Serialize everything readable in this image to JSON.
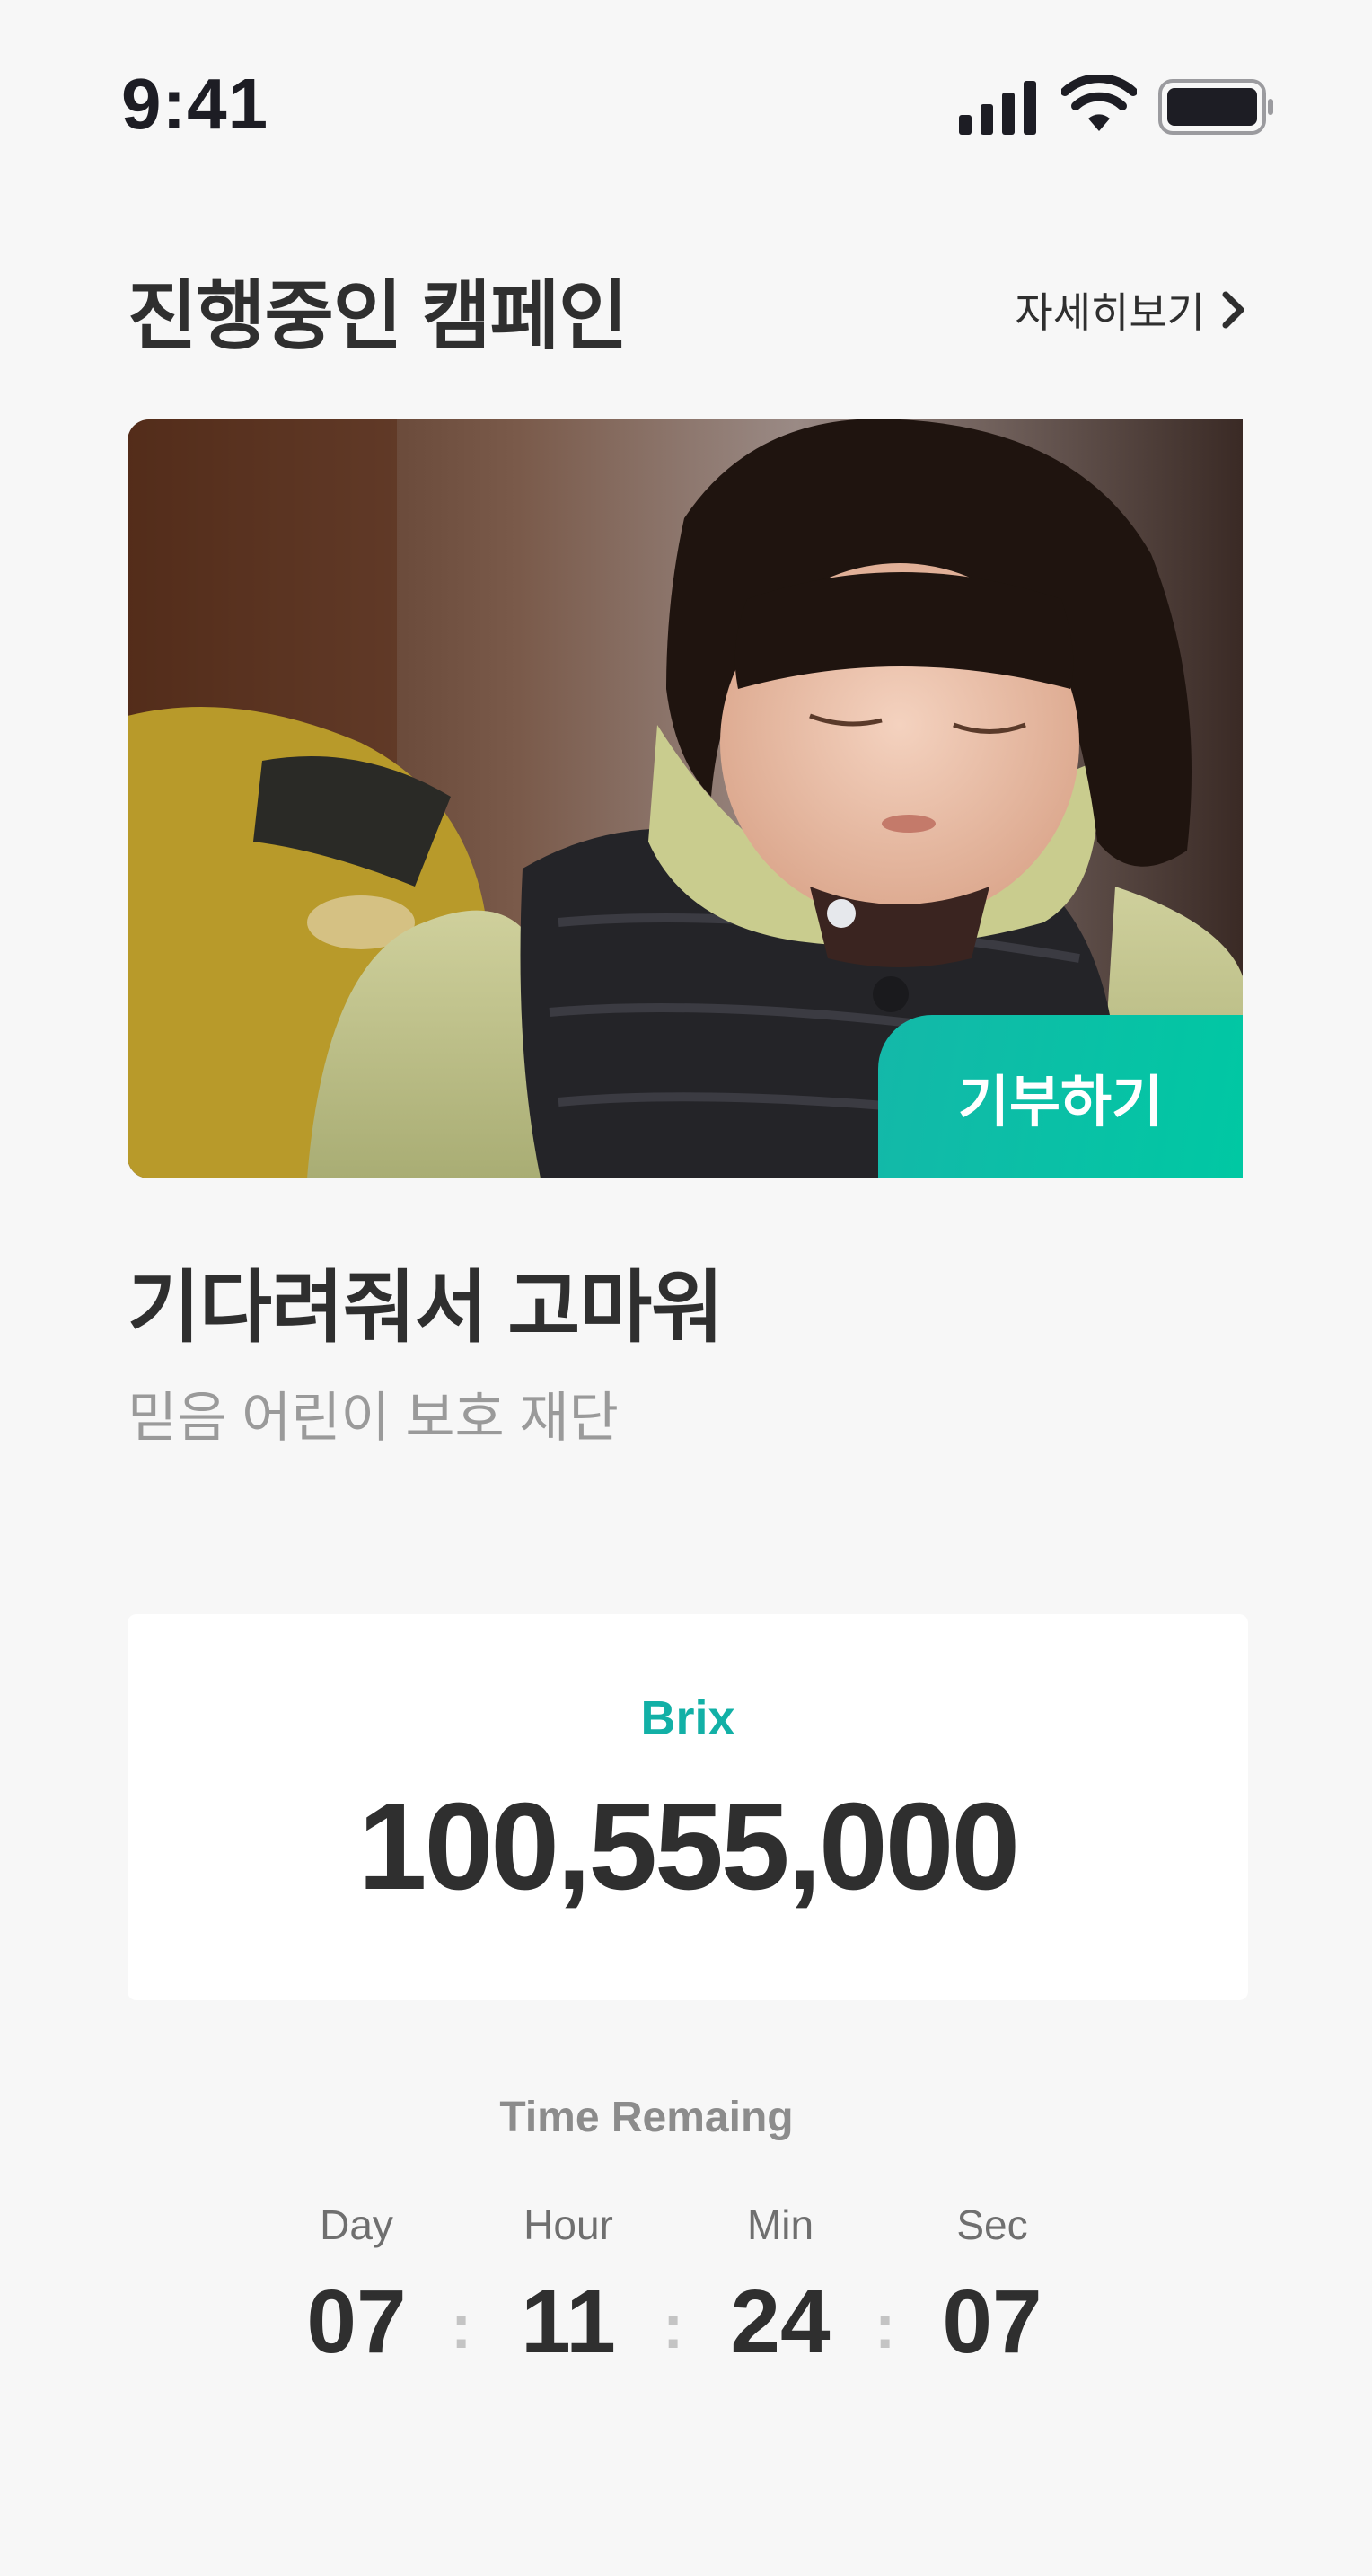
{
  "status_bar": {
    "time": "9:41",
    "icons": [
      "signal-icon",
      "wifi-icon",
      "battery-icon"
    ]
  },
  "header": {
    "title": "진행중인 캠페인",
    "more_label": "자세히보기"
  },
  "campaign": {
    "donate_label": "기부하기",
    "title": "기다려줘서 고마워",
    "organization": "믿음 어린이 보호 재단"
  },
  "amount": {
    "label": "Brix",
    "value": "100,555,000"
  },
  "countdown": {
    "title": "Time Remaing",
    "units": [
      {
        "label": "Day",
        "value": "07"
      },
      {
        "label": "Hour",
        "value": "11"
      },
      {
        "label": "Min",
        "value": "24"
      },
      {
        "label": "Sec",
        "value": "07"
      }
    ],
    "separator": ":"
  },
  "colors": {
    "accent": "#12b0a6",
    "donate_gradient_start": "#14b8a9",
    "donate_gradient_end": "#00c8a3",
    "text": "#2f2f2f",
    "muted": "#9a9a9a"
  }
}
